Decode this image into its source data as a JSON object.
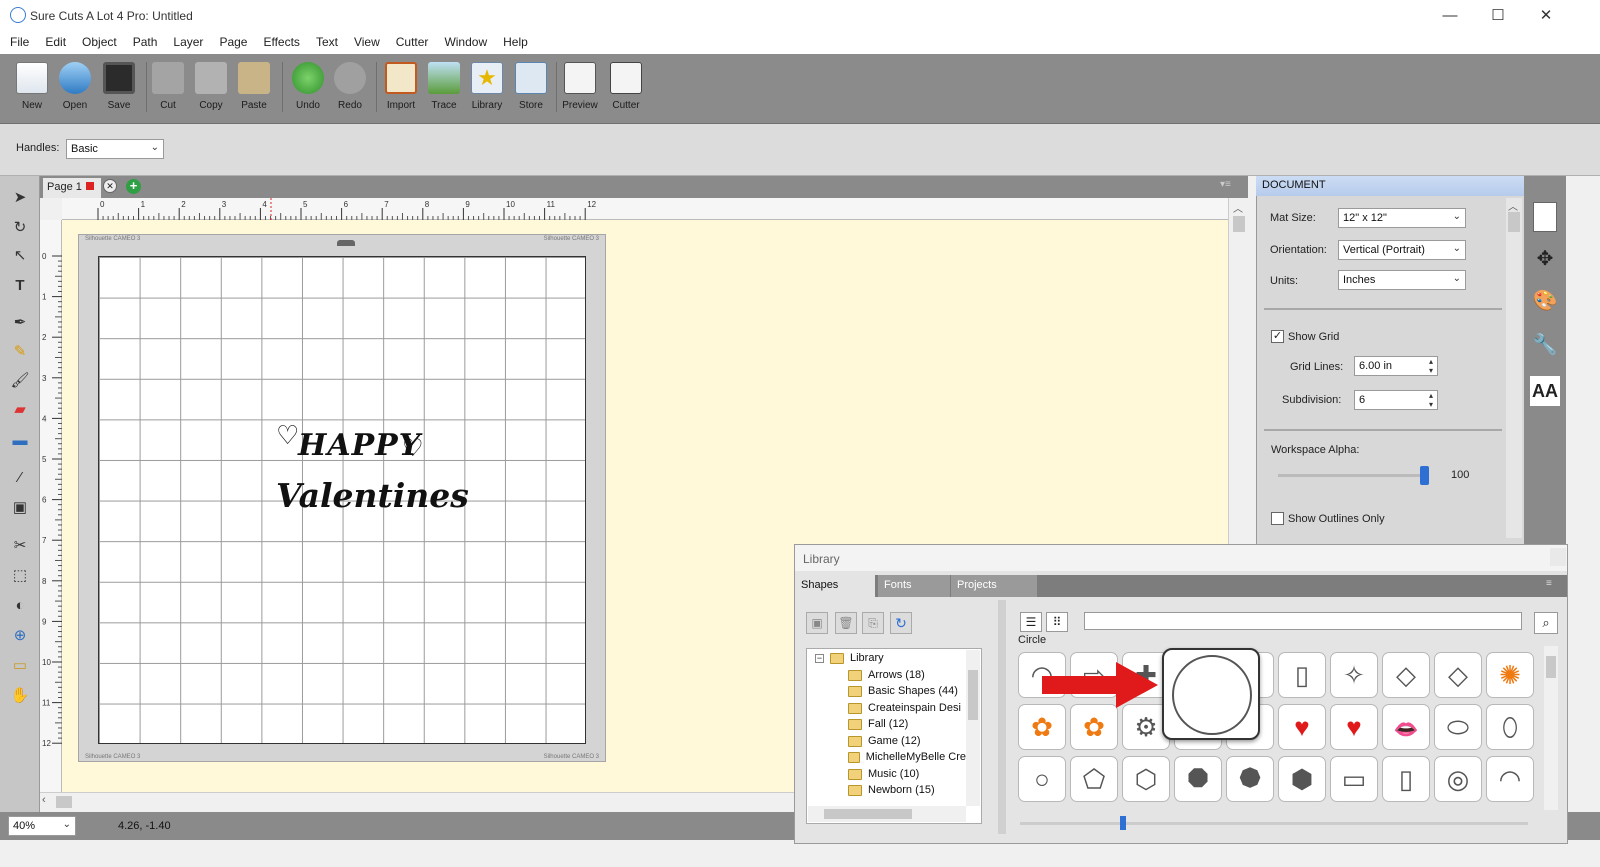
{
  "window": {
    "title": "Sure Cuts A Lot 4 Pro: Untitled",
    "minimize": "—",
    "maximize": "☐",
    "close": "✕"
  },
  "menu": [
    "File",
    "Edit",
    "Object",
    "Path",
    "Layer",
    "Page",
    "Effects",
    "Text",
    "View",
    "Cutter",
    "Window",
    "Help"
  ],
  "toolbar": {
    "items": [
      {
        "label": "New",
        "icon": "new-doc-icon"
      },
      {
        "label": "Open",
        "icon": "open-icon"
      },
      {
        "label": "Save",
        "icon": "save-icon"
      },
      {
        "label": "Cut",
        "icon": "cut-icon"
      },
      {
        "label": "Copy",
        "icon": "copy-icon"
      },
      {
        "label": "Paste",
        "icon": "paste-icon"
      },
      {
        "label": "Undo",
        "icon": "undo-icon"
      },
      {
        "label": "Redo",
        "icon": "redo-icon"
      },
      {
        "label": "Import",
        "icon": "import-icon"
      },
      {
        "label": "Trace",
        "icon": "trace-icon"
      },
      {
        "label": "Library",
        "icon": "library-icon"
      },
      {
        "label": "Store",
        "icon": "store-icon"
      },
      {
        "label": "Preview",
        "icon": "preview-icon"
      },
      {
        "label": "Cutter",
        "icon": "cutter-icon"
      }
    ]
  },
  "options": {
    "handles_label": "Handles:",
    "handles_value": "Basic"
  },
  "page_tab": {
    "label": "Page 1"
  },
  "ruler": {
    "h": [
      "0",
      "1",
      "2",
      "3",
      "4",
      "5",
      "6",
      "7",
      "8",
      "9",
      "10",
      "11",
      "12"
    ],
    "v": [
      "0",
      "1",
      "2",
      "3",
      "4",
      "5",
      "6",
      "7",
      "8",
      "9",
      "10",
      "11",
      "12"
    ]
  },
  "mat": {
    "brand": "Silhouette CAMEO 3"
  },
  "design": {
    "line1": "HAPPY",
    "line2": "Valentines"
  },
  "status": {
    "zoom": "40%",
    "coords": "4.26, -1.40"
  },
  "document": {
    "title": "DOCUMENT",
    "mat_size_label": "Mat Size:",
    "mat_size": "12\" x 12\"",
    "orientation_label": "Orientation:",
    "orientation": "Vertical (Portrait)",
    "units_label": "Units:",
    "units": "Inches",
    "show_grid_label": "Show Grid",
    "show_grid": true,
    "grid_lines_label": "Grid Lines:",
    "grid_lines": "6.00 in",
    "subdivision_label": "Subdivision:",
    "subdivision": "6",
    "alpha_label": "Workspace Alpha:",
    "alpha": "100",
    "alpha_level": 1.0,
    "outlines_label": "Show Outlines Only",
    "outlines": false
  },
  "library": {
    "title": "Library",
    "tabs": [
      "Shapes",
      "Fonts",
      "Projects"
    ],
    "selected_name": "Circle",
    "search": "",
    "tree_root": "Library",
    "tree": [
      "Arrows (18)",
      "Basic Shapes (44)",
      "Createinspain Desi",
      "Fall (12)",
      "Game (12)",
      "MichelleMyBelle Cre",
      "Music (10)",
      "Newborn (15)"
    ],
    "shapes_row1": [
      "◠",
      "⇨",
      "✚",
      "○",
      "▢",
      "▯",
      "✧",
      "◇",
      "◇",
      "✺"
    ],
    "shapes_row2": [
      "✿",
      "✿",
      "⚙",
      "♥",
      "♥",
      "♥",
      "♥",
      "👄",
      "⬭",
      "⬯"
    ],
    "shapes_row3": [
      "○",
      "⬠",
      "⬡",
      "⯃",
      "⯄",
      "⬢",
      "▭",
      "▯",
      "◎",
      "◠"
    ]
  },
  "colors": {
    "accent": "#3a7bd5",
    "arrow": "#e0191b",
    "heart": "#e0191b",
    "flower": "#f07a12",
    "toolbar": "#8b8b8b",
    "mat": "#d4d4d4",
    "canvas": "#fff9d9"
  }
}
